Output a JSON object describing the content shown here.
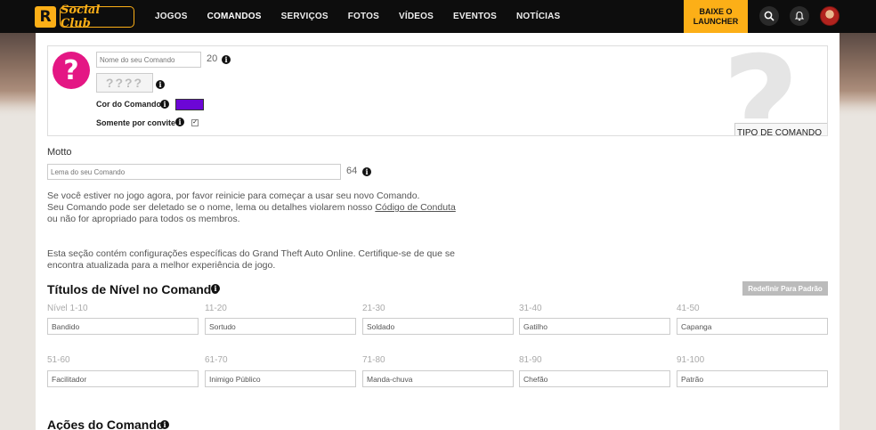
{
  "nav": {
    "logo_r": "R",
    "logo_text": "Social Club",
    "items": [
      "JOGOS",
      "COMANDOS",
      "SERVIÇOS",
      "FOTOS",
      "VÍDEOS",
      "EVENTOS",
      "NOTÍCIAS"
    ],
    "active_item": "COMANDOS",
    "launcher_line1": "BAIXE O",
    "launcher_line2": "LAUNCHER"
  },
  "crew": {
    "emblem_glyph": "?",
    "name_placeholder": "Nome do seu Comando",
    "name_counter": "20",
    "tag_value": "????",
    "color_label": "Cor do Comando",
    "color_value": "#6c06d6",
    "invite_label": "Somente por convite",
    "invite_checked": true,
    "type_select_label": "TIPO DE COMANDO"
  },
  "motto": {
    "label": "Motto",
    "placeholder": "Lema do seu Comando",
    "counter": "64"
  },
  "notice": {
    "line1": "Se você estiver no jogo agora, por favor reinicie para começar a usar seu novo Comando.",
    "line2_pre": "Seu Comando pode ser deletado se o nome, lema ou detalhes violarem nosso ",
    "line2_link": "Código de Conduta",
    "line3": "ou não for apropriado para todos os membros."
  },
  "gta_notice": {
    "line1": "Esta seção contém configurações específicas do Grand Theft Auto Online. Certifique-se de que se",
    "line2": "encontra atualizada para a melhor experiência de jogo."
  },
  "ranks": {
    "title": "Títulos de Nível no Comando",
    "reset_label": "Redefinir Para Padrão",
    "items": [
      {
        "range": "Nível 1-10",
        "title": "Bandido"
      },
      {
        "range": "11-20",
        "title": "Sortudo"
      },
      {
        "range": "21-30",
        "title": "Soldado"
      },
      {
        "range": "31-40",
        "title": "Gatilho"
      },
      {
        "range": "41-50",
        "title": "Capanga"
      },
      {
        "range": "51-60",
        "title": "Facilitador"
      },
      {
        "range": "61-70",
        "title": "Inimigo Público"
      },
      {
        "range": "71-80",
        "title": "Manda-chuva"
      },
      {
        "range": "81-90",
        "title": "Chefão"
      },
      {
        "range": "91-100",
        "title": "Patrão"
      }
    ]
  },
  "actions": {
    "title": "Ações do Comando"
  },
  "icons": {
    "info": "info-icon",
    "search": "search-icon",
    "bell": "bell-icon",
    "select_arrows": "select-arrows-icon"
  },
  "colors": {
    "accent": "#fcaf17",
    "emblem": "#e41784",
    "crew_color": "#6c06d6"
  }
}
